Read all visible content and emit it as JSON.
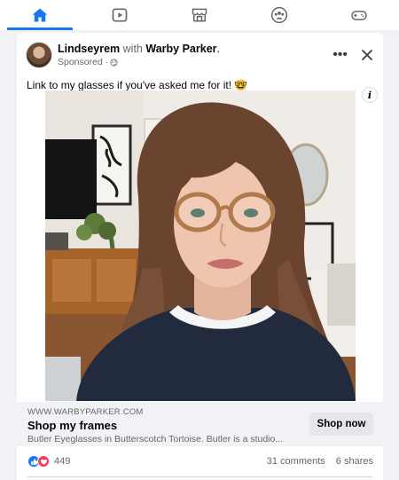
{
  "nav": {
    "tabs": [
      {
        "name": "home",
        "icon": "home-icon",
        "active": true
      },
      {
        "name": "watch",
        "icon": "video-icon",
        "active": false
      },
      {
        "name": "marketplace",
        "icon": "marketplace-icon",
        "active": false
      },
      {
        "name": "groups",
        "icon": "groups-icon",
        "active": false
      },
      {
        "name": "gaming",
        "icon": "gaming-icon",
        "active": false
      }
    ],
    "accent_color": "#1877f2",
    "inactive_color": "#65676b"
  },
  "post": {
    "author": "Lindseyrem",
    "with_text": "with",
    "partner": "Warby Parker",
    "partner_suffix": ".",
    "sponsored_label": "Sponsored ·",
    "caption": "Link to my glasses if you've asked me for it! 🤓",
    "more_label": "•••",
    "info_label": "i"
  },
  "cta": {
    "domain": "WWW.WARBYPARKER.COM",
    "title": "Shop my frames",
    "description": "Butler Eyeglasses in Butterscotch Tortoise. Butler is a studio...",
    "button_label": "Shop now"
  },
  "stats": {
    "reaction_count": "449",
    "comments": "31 comments",
    "shares": "6 shares",
    "like_color": "#1877f2",
    "love_color": "#f33e58"
  }
}
